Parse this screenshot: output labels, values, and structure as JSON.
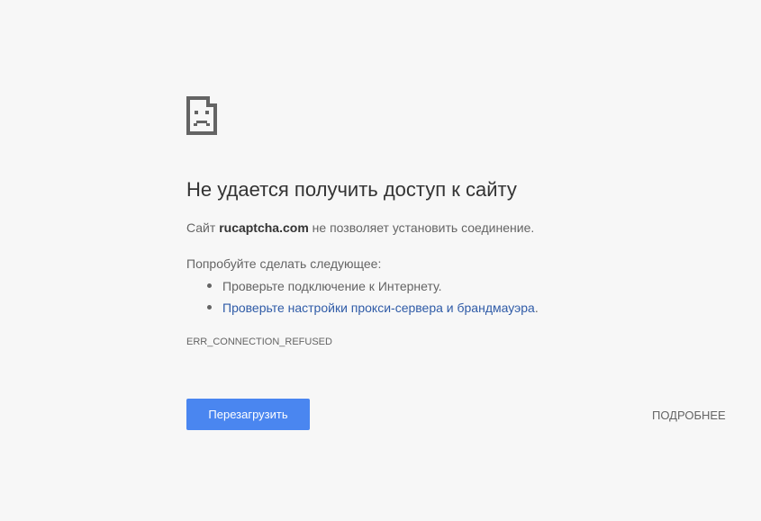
{
  "error_page": {
    "icon": "sad-page-icon",
    "title": "Не удается получить доступ к сайту",
    "summary": {
      "prefix": "Сайт ",
      "host": "rucaptcha.com",
      "suffix": " не позволяет установить соединение."
    },
    "suggestions_heading": "Попробуйте сделать следующее:",
    "suggestions": [
      {
        "text": "Проверьте подключение к Интернету.",
        "is_link": false
      },
      {
        "text": "Проверьте настройки прокси-сервера и брандмауэра",
        "trailing": ".",
        "is_link": true
      }
    ],
    "error_code": "ERR_CONNECTION_REFUSED",
    "reload_label": "Перезагрузить",
    "details_label": "ПОДРОБНЕЕ",
    "colors": {
      "background": "#f7f7f7",
      "title": "#333333",
      "body_text": "#646464",
      "link": "#2f5ba7",
      "button": "#4a86f0",
      "button_text": "#ffffff"
    }
  }
}
